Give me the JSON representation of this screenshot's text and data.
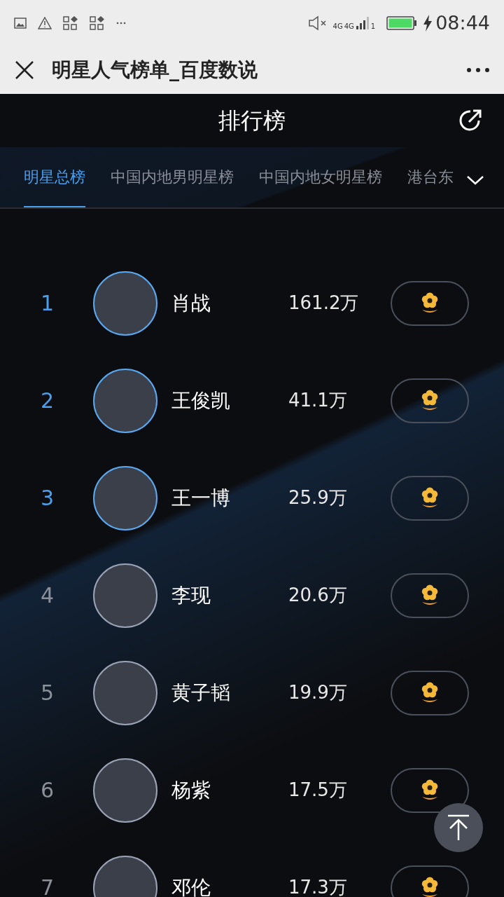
{
  "status_bar": {
    "network": "4G",
    "network_2": "4G",
    "sim": "1",
    "time": "08:44"
  },
  "title_bar": {
    "title": "明星人气榜单_百度数说"
  },
  "header": {
    "title": "排行榜"
  },
  "tabs": [
    {
      "label": "明星总榜",
      "selected": true
    },
    {
      "label": "中国内地男明星榜",
      "selected": false
    },
    {
      "label": "中国内地女明星榜",
      "selected": false
    },
    {
      "label": "港台东",
      "selected": false
    }
  ],
  "rows": [
    {
      "rank": "1",
      "name": "肖战",
      "score": "161.2万",
      "top": true
    },
    {
      "rank": "2",
      "name": "王俊凯",
      "score": "41.1万",
      "top": true
    },
    {
      "rank": "3",
      "name": "王一博",
      "score": "25.9万",
      "top": true
    },
    {
      "rank": "4",
      "name": "李现",
      "score": "20.6万",
      "top": false
    },
    {
      "rank": "5",
      "name": "黄子韬",
      "score": "19.9万",
      "top": false
    },
    {
      "rank": "6",
      "name": "杨紫",
      "score": "17.5万",
      "top": false
    },
    {
      "rank": "7",
      "name": "邓伦",
      "score": "17.3万",
      "top": false
    }
  ]
}
